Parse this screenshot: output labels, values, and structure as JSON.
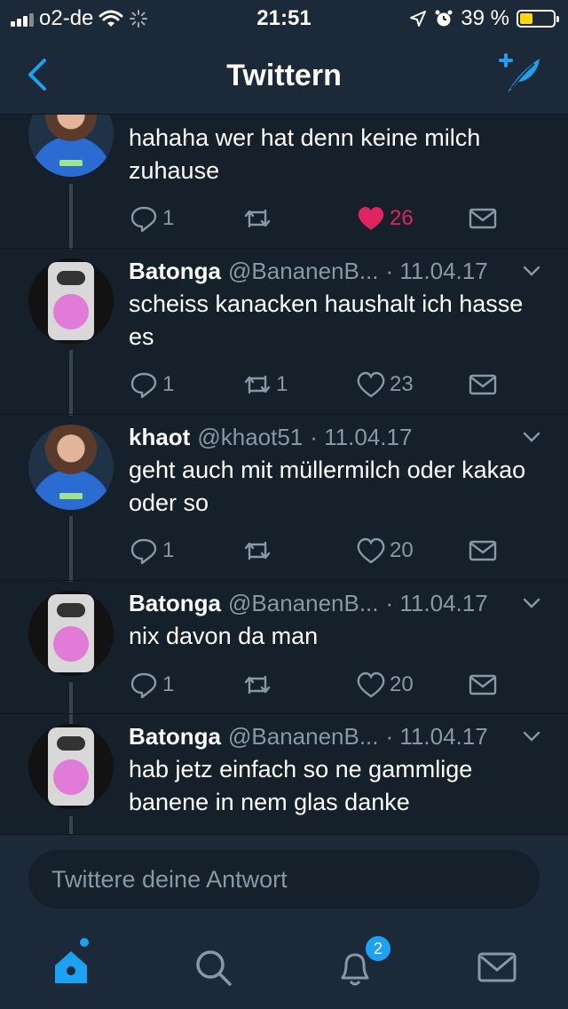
{
  "status_bar": {
    "carrier": "o2-de",
    "time": "21:51",
    "battery": "39 %",
    "battery_level": 0.39
  },
  "navbar": {
    "title": "Twittern"
  },
  "tweets": [
    {
      "name": "",
      "handle": "",
      "date": "",
      "text": "hahaha wer hat denn keine milch zuhause",
      "replies": "1",
      "retweets": "",
      "likes": "26",
      "liked": true
    },
    {
      "name": "Batonga",
      "handle": "@BananenB...",
      "date": "· 11.04.17",
      "text": "scheiss kanacken haushalt ich hasse es",
      "replies": "1",
      "retweets": "1",
      "likes": "23",
      "liked": false
    },
    {
      "name": "khaot",
      "handle": "@khaot51",
      "date": "· 11.04.17",
      "text": "geht auch mit müllermilch oder kakao oder so",
      "replies": "1",
      "retweets": "",
      "likes": "20",
      "liked": false
    },
    {
      "name": "Batonga",
      "handle": "@BananenB...",
      "date": "· 11.04.17",
      "text": "nix davon da man",
      "replies": "1",
      "retweets": "",
      "likes": "20",
      "liked": false
    },
    {
      "name": "Batonga",
      "handle": "@BananenB...",
      "date": "· 11.04.17",
      "text": "hab jetz einfach so ne gammlige banene in nem glas danke",
      "replies": "",
      "retweets": "",
      "likes": "",
      "liked": false
    }
  ],
  "composer": {
    "placeholder": "Twittere deine Antwort"
  },
  "tabbar": {
    "items": [
      "home-icon",
      "search-icon",
      "notifications-icon",
      "messages-icon"
    ],
    "notifications_badge": "2"
  },
  "colors": {
    "background": "#15202b",
    "bar": "#1c2938",
    "accent": "#1da1f2",
    "like": "#e0245e",
    "muted": "#8899a6"
  }
}
